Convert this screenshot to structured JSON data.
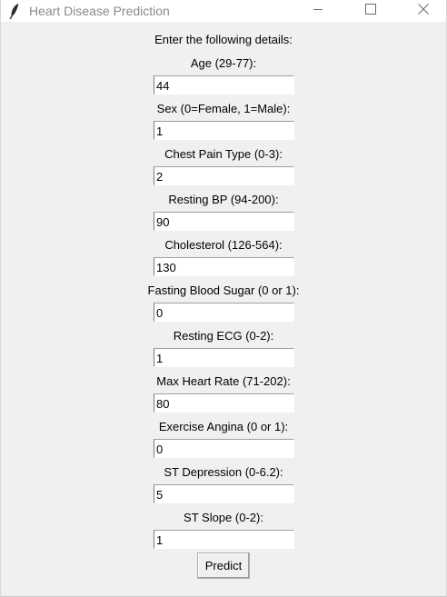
{
  "window": {
    "title": "Heart Disease Prediction",
    "controls": [
      "minimize",
      "maximize",
      "close"
    ]
  },
  "form": {
    "heading": "Enter the following details:",
    "fields": [
      {
        "label": "Age (29-77):",
        "value": "44"
      },
      {
        "label": "Sex (0=Female, 1=Male):",
        "value": "1"
      },
      {
        "label": "Chest Pain Type (0-3):",
        "value": "2"
      },
      {
        "label": "Resting BP (94-200):",
        "value": "90"
      },
      {
        "label": "Cholesterol (126-564):",
        "value": "130"
      },
      {
        "label": "Fasting Blood Sugar (0 or 1):",
        "value": "0"
      },
      {
        "label": "Resting ECG (0-2):",
        "value": "1"
      },
      {
        "label": "Max Heart Rate (71-202):",
        "value": "80"
      },
      {
        "label": "Exercise Angina (0 or 1):",
        "value": "0"
      },
      {
        "label": "ST Depression (0-6.2):",
        "value": "5"
      },
      {
        "label": "ST Slope (0-2):",
        "value": "1"
      }
    ],
    "predict_label": "Predict"
  },
  "icons": {
    "app": "feather-icon",
    "minimize": "minimize-icon",
    "maximize": "maximize-icon",
    "close": "close-icon"
  }
}
